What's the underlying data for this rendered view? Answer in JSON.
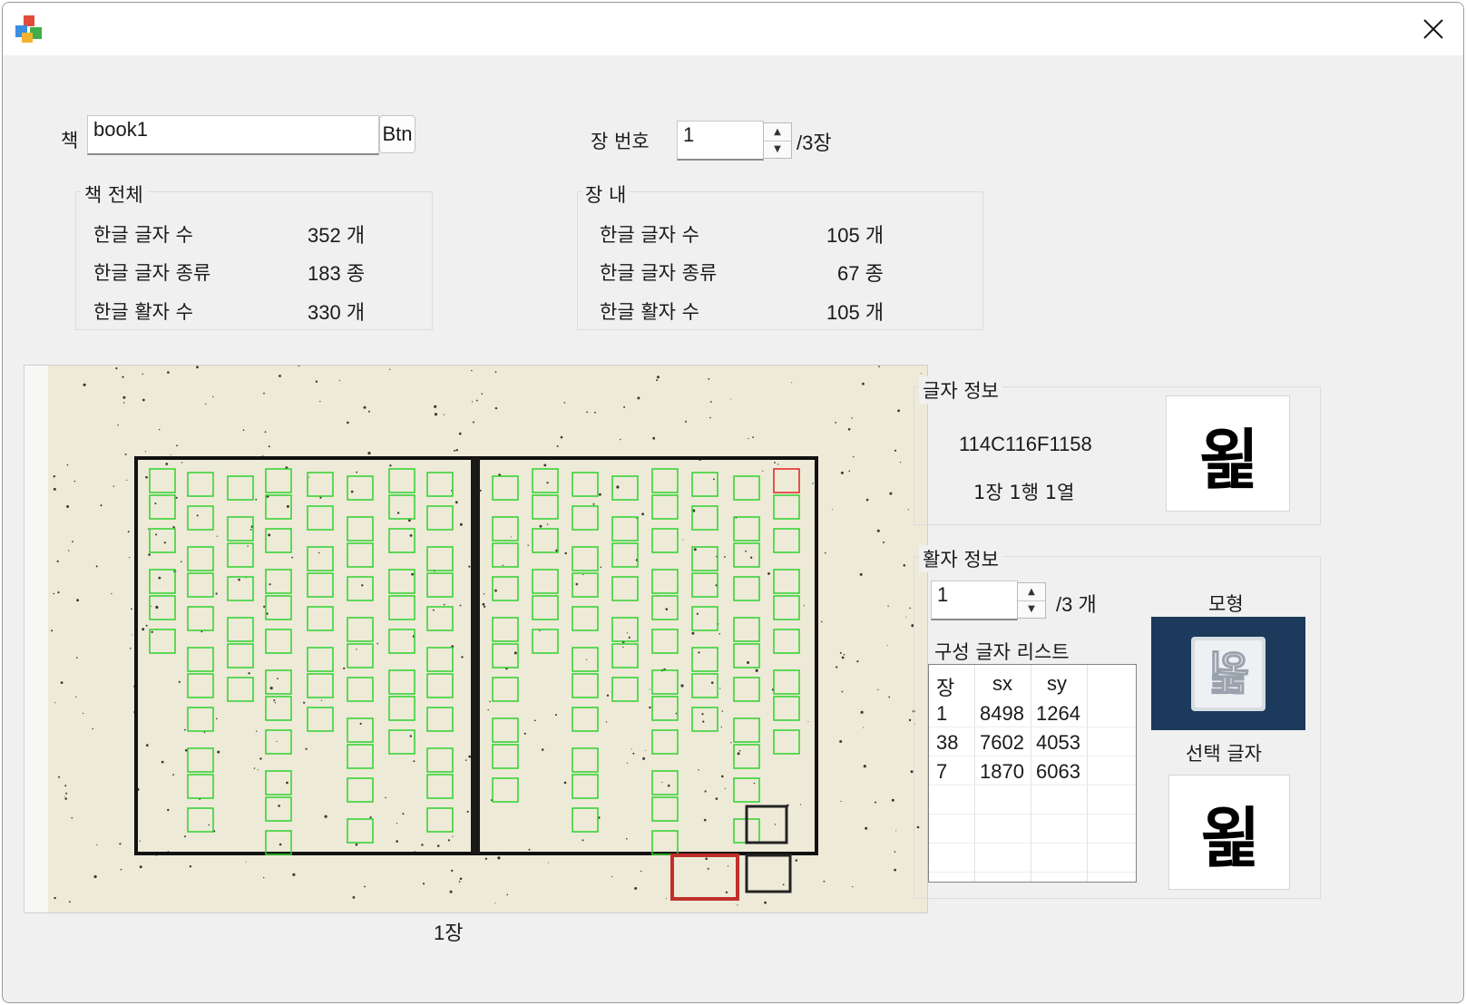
{
  "book": {
    "label": "책",
    "value": "book1",
    "button": "Btn"
  },
  "page_nav": {
    "label": "장 번호",
    "value": "1",
    "total": "/3장"
  },
  "book_stats": {
    "title": "책 전체",
    "rows": [
      {
        "label": "한글 글자 수",
        "value": "352 개"
      },
      {
        "label": "한글 글자 종류",
        "value": "183 종"
      },
      {
        "label": "한글 활자 수",
        "value": "330 개"
      }
    ]
  },
  "page_stats": {
    "title": "장 내",
    "rows": [
      {
        "label": "한글 글자 수",
        "value": "105 개"
      },
      {
        "label": "한글 글자 종류",
        "value": "67 종"
      },
      {
        "label": "한글 활자 수",
        "value": "105 개"
      }
    ]
  },
  "page_caption": "1장",
  "char_info": {
    "title": "글자 정보",
    "code": "114C116F1158",
    "position": "1장 1행 1열",
    "glyph": "욅"
  },
  "type_info": {
    "title": "활자 정보",
    "spin_value": "1",
    "spin_total": "/3 개",
    "list_title": "구성 글자 리스트",
    "columns": [
      "장",
      "sx",
      "sy"
    ],
    "rows": [
      [
        "1",
        "8498",
        "1264"
      ],
      [
        "38",
        "7602",
        "4053"
      ],
      [
        "7",
        "1870",
        "6063"
      ]
    ],
    "model_label": "모형",
    "selected_label": "선택 글자",
    "selected_glyph": "욅"
  },
  "colors": {
    "window_bg": "#f0f0f0",
    "model_bg": "#1b3a5c",
    "box_green": "#2fd12f",
    "box_red": "#e02020",
    "seal_red": "#c0302a"
  }
}
